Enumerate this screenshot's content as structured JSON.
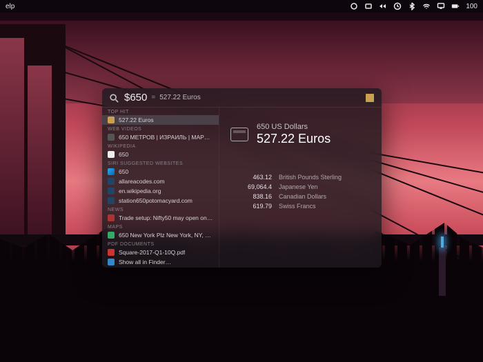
{
  "menubar": {
    "left_item": "elp",
    "battery": "100"
  },
  "spotlight": {
    "query": "$650",
    "equals": "=",
    "result_inline": "527.22 Euros",
    "groups": [
      {
        "header": "TOP HIT",
        "rows": [
          {
            "icon": "calc",
            "label": "527.22 Euros",
            "selected": true
          }
        ]
      },
      {
        "header": "WEB VIDEOS",
        "rows": [
          {
            "icon": "video",
            "label": "650 МЕТРОВ | ИЗРАИЛЬ | МАРЬЯ…"
          }
        ]
      },
      {
        "header": "WIKIPEDIA",
        "rows": [
          {
            "icon": "wiki",
            "label": "650"
          }
        ]
      },
      {
        "header": "SIRI SUGGESTED WEBSITES",
        "rows": [
          {
            "icon": "safari",
            "label": "650"
          },
          {
            "icon": "url",
            "label": "allareacodes.com"
          },
          {
            "icon": "url",
            "label": "en.wikipedia.org"
          },
          {
            "icon": "url",
            "label": "station650potomacyard.com"
          }
        ]
      },
      {
        "header": "NEWS",
        "rows": [
          {
            "icon": "news",
            "label": "Trade setup: Nifty50 may open on…"
          }
        ]
      },
      {
        "header": "MAPS",
        "rows": [
          {
            "icon": "map",
            "label": "650 New York Plz New York, NY, U…"
          }
        ]
      },
      {
        "header": "PDF DOCUMENTS",
        "rows": [
          {
            "icon": "pdf",
            "label": "Square-2017-Q1-10Q.pdf"
          },
          {
            "icon": "finder",
            "label": "Show all in Finder…"
          }
        ]
      }
    ],
    "detail": {
      "from": "650 US Dollars",
      "to": "527.22 Euros",
      "rates": [
        {
          "value": "463.12",
          "currency": "British Pounds Sterling"
        },
        {
          "value": "69,064.4",
          "currency": "Japanese Yen"
        },
        {
          "value": "838.16",
          "currency": "Canadian Dollars"
        },
        {
          "value": "619.79",
          "currency": "Swiss Francs"
        }
      ]
    }
  }
}
